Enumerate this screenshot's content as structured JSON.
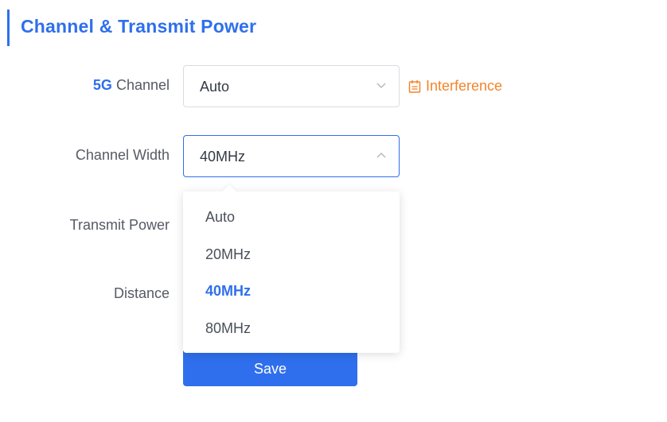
{
  "section": {
    "title": "Channel & Transmit Power"
  },
  "fields": {
    "channel": {
      "label_highlight": "5G",
      "label_rest": " Channel",
      "value": "Auto"
    },
    "channel_width": {
      "label": "Channel Width",
      "value": "40MHz"
    },
    "transmit_power": {
      "label": "Transmit Power"
    },
    "distance": {
      "label": "Distance"
    }
  },
  "interference": {
    "label": "Interference",
    "icon": "calendar-icon"
  },
  "dropdown": {
    "options": [
      "Auto",
      "20MHz",
      "40MHz",
      "80MHz"
    ],
    "selected": "40MHz"
  },
  "actions": {
    "save_label": "Save"
  },
  "colors": {
    "accent": "#2f6fed",
    "interference": "#f5842a"
  }
}
